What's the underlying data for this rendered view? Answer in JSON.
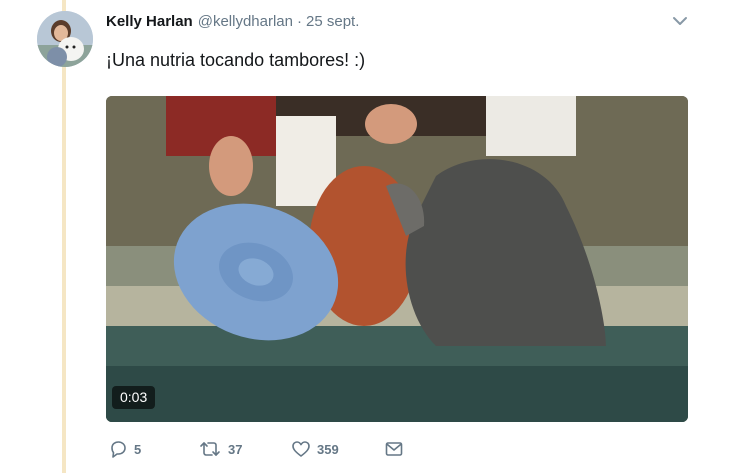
{
  "tweet": {
    "author_name": "Kelly Harlan",
    "author_handle": "@kellydharlan",
    "separator": "·",
    "date": "25 sept.",
    "text": "¡Una nutria tocando tambores! :)"
  },
  "media": {
    "duration": "0:03"
  },
  "actions": {
    "reply_count": "5",
    "retweet_count": "37",
    "like_count": "359"
  },
  "icons": {
    "reply": "reply-icon",
    "retweet": "retweet-icon",
    "like": "like-icon",
    "message": "message-icon",
    "caret": "chevron-down-icon"
  },
  "colors": {
    "name": "#14171a",
    "secondary": "#657786",
    "thread_line": "#f5e6c4"
  }
}
